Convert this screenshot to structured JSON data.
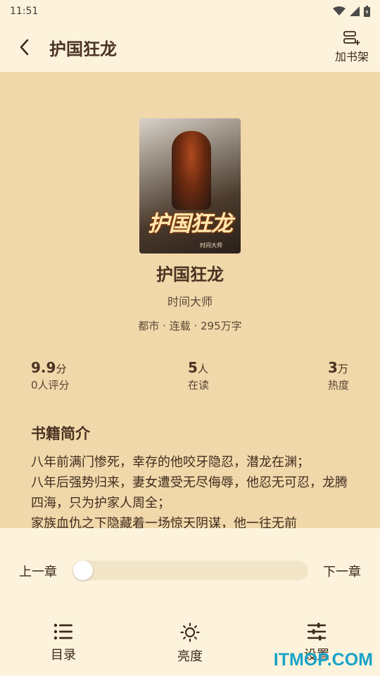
{
  "status_bar": {
    "time": "11:51"
  },
  "app_bar": {
    "title": "护国狂龙",
    "add_shelf_label": "加书架"
  },
  "book": {
    "cover_title": "护国狂龙",
    "cover_author": "时间大师",
    "title": "护国狂龙",
    "author": "时间大师",
    "meta": "都市 · 连载 · 295万字"
  },
  "stats": [
    {
      "value": "9.9",
      "unit": "分",
      "label": "0人评分"
    },
    {
      "value": "5",
      "unit": "人",
      "label": "在读"
    },
    {
      "value": "3",
      "unit": "万",
      "label": "热度"
    }
  ],
  "intro": {
    "heading": "书籍简介",
    "text": "八年前满门惨死，幸存的他咬牙隐忍，潜龙在渊；\n八年后强势归来，妻女遭受无尽侮辱，他忍无可忍，龙腾四海，只为护家人周全；\n家族血仇之下隐藏着一场惊天阴谋，他一往无前"
  },
  "reader_controls": {
    "prev_chapter": "上一章",
    "next_chapter": "下一章",
    "progress": 0.0,
    "nav": [
      {
        "label": "目录",
        "icon": "list-icon"
      },
      {
        "label": "亮度",
        "icon": "sun-icon"
      },
      {
        "label": "设置",
        "icon": "sliders-icon"
      }
    ]
  },
  "watermark": "ITMOP.COM",
  "colors": {
    "page_bg": "#f1d8aa",
    "bar_bg": "#fdf3dc",
    "text_dark": "#4a3322",
    "watermark": "#18a3c9"
  }
}
